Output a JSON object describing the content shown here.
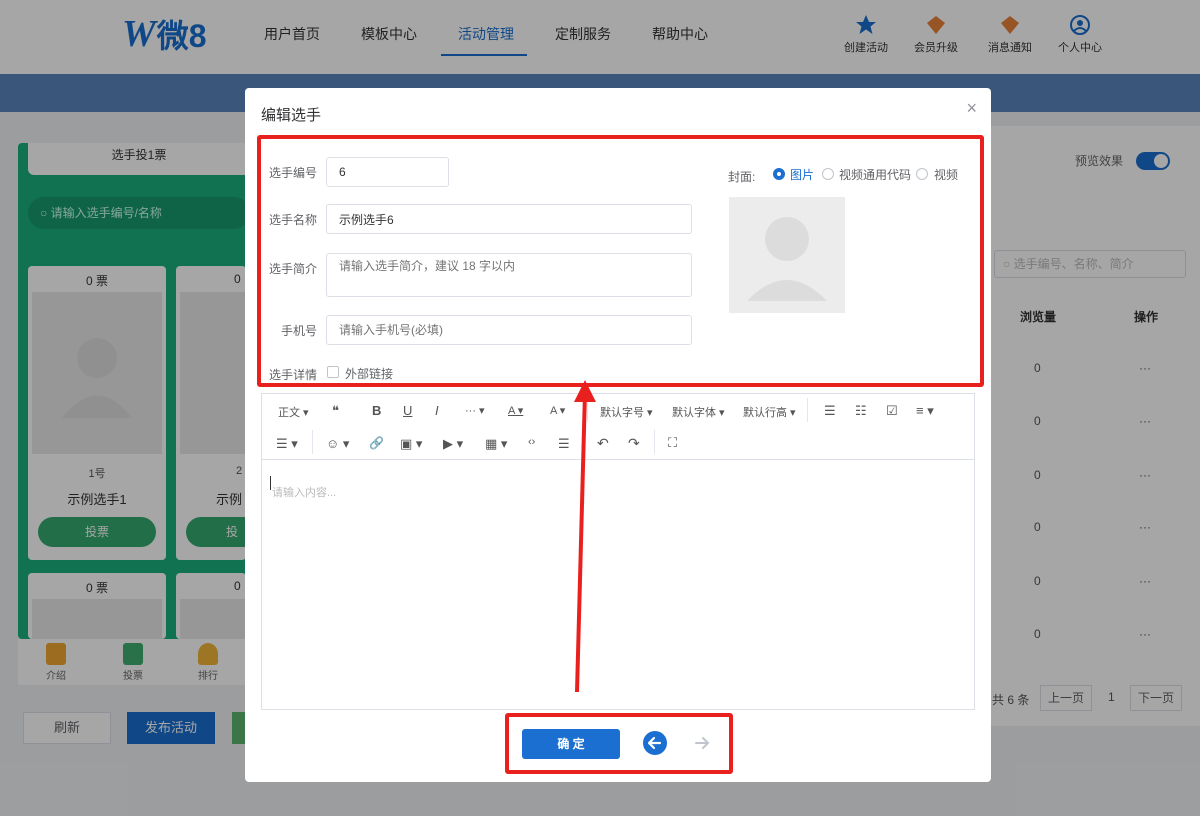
{
  "header": {
    "logo_letter": "W",
    "logo_text": "微8",
    "nav": [
      "用户首页",
      "模板中心",
      "活动管理",
      "定制服务",
      "帮助中心"
    ],
    "active_nav": "活动管理",
    "right_items": [
      {
        "label": "创建活动",
        "icon": "star-icon"
      },
      {
        "label": "会员升级",
        "icon": "diamond-icon"
      },
      {
        "label": "消息通知",
        "icon": "bell-icon"
      },
      {
        "label": "个人中心",
        "icon": "user-circle-icon"
      }
    ]
  },
  "preview": {
    "tab_title": "选手投1票",
    "search_placeholder": "请输入选手编号/名称",
    "cards": [
      {
        "votes": "0 票",
        "number": "1号",
        "name": "示例选手1",
        "vote_btn": "投票"
      },
      {
        "votes": "0",
        "number": "2",
        "name": "示例",
        "vote_btn": "投"
      },
      {
        "votes": "0 票"
      },
      {
        "votes": "0"
      }
    ],
    "bottom_nav": [
      "介绍",
      "投票",
      "排行"
    ]
  },
  "actions": {
    "refresh": "刷新",
    "publish": "发布活动"
  },
  "list": {
    "preview_label": "预览效果",
    "search_placeholder": "选手编号、名称、简介",
    "columns": [
      "浏览量",
      "操作"
    ],
    "rows": [
      {
        "views": "0",
        "action": "···"
      },
      {
        "views": "0",
        "action": "···"
      },
      {
        "views": "0",
        "action": "···"
      },
      {
        "views": "0",
        "action": "···"
      },
      {
        "views": "0",
        "action": "···"
      },
      {
        "views": "0",
        "action": "···"
      }
    ],
    "total": "共 6 条",
    "prev": "上一页",
    "page": "1",
    "next": "下一页"
  },
  "modal": {
    "title": "编辑选手",
    "close": "×",
    "fields": {
      "number_label": "选手编号",
      "number_value": "6",
      "name_label": "选手名称",
      "name_value": "示例选手6",
      "intro_label": "选手简介",
      "intro_placeholder": "请输入选手简介，建议 18 字以内",
      "phone_label": "手机号",
      "phone_placeholder": "请输入手机号(必填)",
      "detail_label": "选手详情",
      "external_link": "外部链接"
    },
    "cover": {
      "label": "封面:",
      "options": [
        "图片",
        "视频通用代码",
        "视频"
      ],
      "selected": "图片"
    },
    "toolbar": {
      "row1": [
        "正文 ▾",
        "❝",
        "B",
        "U",
        "I",
        "··· ▾",
        "A ▾",
        "A ▾",
        "默认字号 ▾",
        "默认字体 ▾",
        "默认行高 ▾",
        "☰",
        "☷",
        "☑",
        "≡ ▾"
      ],
      "row2": [
        "☰ ▾",
        "☺ ▾",
        "🔗",
        "▣ ▾",
        "▶ ▾",
        "▦ ▾",
        "‹›",
        "☰",
        "↶",
        "↷",
        "⛶"
      ]
    },
    "editor_placeholder": "请输入内容...",
    "confirm": "确 定"
  },
  "colors": {
    "primary": "#1a6fd0",
    "highlight": "#e8211f",
    "preview_green": "#1aaf7c"
  }
}
